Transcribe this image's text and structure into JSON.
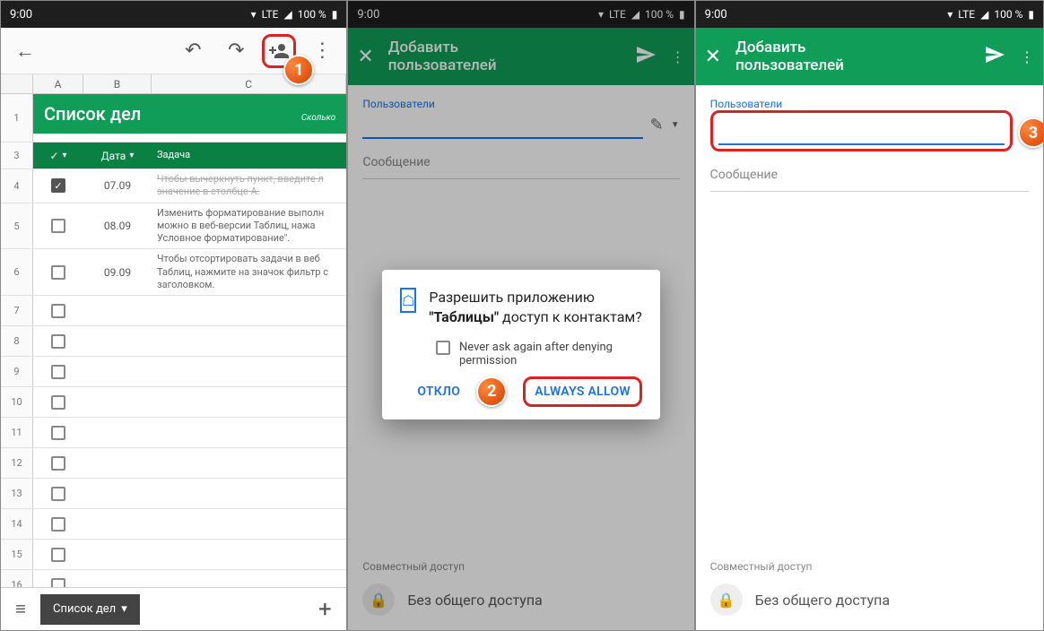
{
  "status": {
    "time": "9:00",
    "net": "LTE",
    "battery": "100 %"
  },
  "badges": {
    "b1": "1",
    "b2": "2",
    "b3": "3"
  },
  "panel1": {
    "colA": "A",
    "colB": "B",
    "colC": "C",
    "title": "Список дел",
    "subtitle": "Сколько",
    "hDate": "Дата",
    "hTask": "Задача",
    "rows": [
      {
        "n": "1"
      },
      {
        "n": "3"
      },
      {
        "n": "4",
        "date": "07.09",
        "text": "Чтобы вычеркнуть пункт, введите л значение в столбце A.",
        "checked": true,
        "strike": true
      },
      {
        "n": "5",
        "date": "08.09",
        "text": "Изменить форматирование выполн можно в веб-версии Таблиц, нажа Условное форматирование\"."
      },
      {
        "n": "6",
        "date": "09.09",
        "text": "Чтобы отсортировать задачи в веб Таблиц, нажмите на значок фильтр с заголовком."
      },
      {
        "n": "7"
      },
      {
        "n": "8"
      },
      {
        "n": "9"
      },
      {
        "n": "10"
      },
      {
        "n": "11"
      },
      {
        "n": "12"
      },
      {
        "n": "13"
      },
      {
        "n": "14"
      },
      {
        "n": "15"
      },
      {
        "n": "16"
      }
    ],
    "tab": "Список дел"
  },
  "share": {
    "title1": "Добавить",
    "title2": "пользователей",
    "usersLabel": "Пользователи",
    "msgLabel": "Сообщение",
    "footerTitle": "Совместный доступ",
    "footerText": "Без общего доступа"
  },
  "dialog": {
    "text1": "Разрешить приложению ",
    "textBold": "\"Таблицы\"",
    "text2": " доступ к контактам?",
    "never": "Never ask again after denying permission",
    "deny": "ОТКЛО",
    "allow": "ALWAYS ALLOW"
  }
}
